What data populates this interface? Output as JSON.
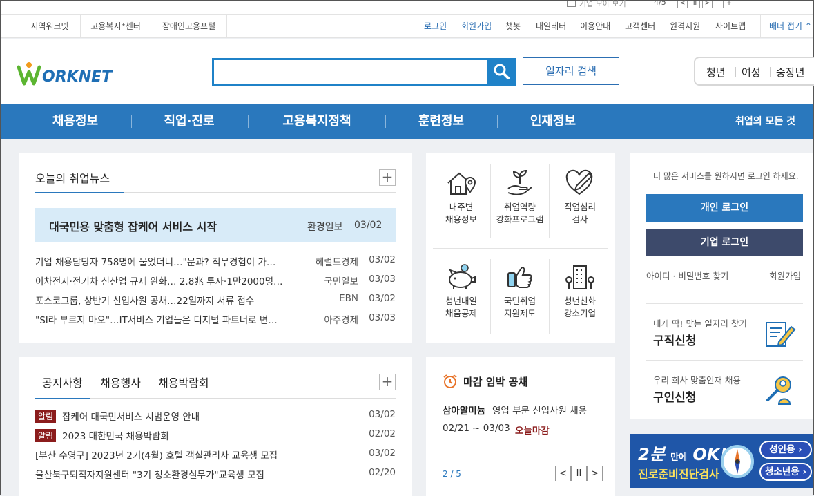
{
  "top_strip": {
    "faded_text": "기업 모아 보기",
    "page": "4/5",
    "pause": "II",
    "prev": "<",
    "next": ">",
    "plus": "+"
  },
  "util": {
    "left_links": [
      "지역워크넷",
      "고용복지⁺센터",
      "장애인고용포털"
    ],
    "right_links": [
      "로그인",
      "회원가입",
      "챗봇",
      "내일레터",
      "이용안내",
      "고객센터",
      "원격지원",
      "사이트맵"
    ],
    "banner_fold": "배너 접기"
  },
  "header": {
    "logo_text": "WORKNET",
    "search_placeholder": "",
    "job_search_label": "일자리 검색",
    "targets": [
      "청년",
      "여성",
      "중장년"
    ]
  },
  "gnb": {
    "items": [
      "채용정보",
      "직업·진로",
      "고용복지정책",
      "훈련정보",
      "인재정보"
    ],
    "all_label": "취업의 모든 것"
  },
  "news": {
    "title": "오늘의 취업뉴스",
    "highlight": {
      "title": "대국민용 맞춤형 잡케어 서비스 시작",
      "source": "환경일보",
      "date": "03/02"
    },
    "items": [
      {
        "title": "기업 채용담당자 758명에 물었더니…\"문과? 직무경험이 가…",
        "source": "헤럴드경제",
        "date": "03/02"
      },
      {
        "title": "이차전지·전기차 신산업 규제 완화… 2.8兆 투자·1만2000명…",
        "source": "국민일보",
        "date": "03/03"
      },
      {
        "title": "포스코그룹, 상반기 신입사원 공채…22일까지 서류 접수",
        "source": "EBN",
        "date": "03/02"
      },
      {
        "title": "\"SI라 부르지 마오\"…IT서비스 기업들은 디지털 파트너로 변…",
        "source": "아주경제",
        "date": "03/03"
      }
    ]
  },
  "services": {
    "items": [
      {
        "label_line1": "내주변",
        "label_line2": "채용정보",
        "icon": "house-location-icon"
      },
      {
        "label_line1": "취업역량",
        "label_line2": "강화프로그램",
        "icon": "hand-sprout-icon"
      },
      {
        "label_line1": "직업심리",
        "label_line2": "검사",
        "icon": "heart-pen-icon"
      },
      {
        "label_line1": "청년내일",
        "label_line2": "채움공제",
        "icon": "piggy-bank-icon"
      },
      {
        "label_line1": "국민취업",
        "label_line2": "지원제도",
        "icon": "thumbs-up-phone-icon"
      },
      {
        "label_line1": "청년친화",
        "label_line2": "강소기업",
        "icon": "building-icon"
      }
    ]
  },
  "login": {
    "hint": "더 많은 서비스를 원하시면 로그인 하세요.",
    "personal": "개인 로그인",
    "company": "기업 로그인",
    "find": "아이디 · 비밀번호 찾기",
    "join": "회원가입",
    "job_seek": {
      "sub": "내게 딱! 맞는 일자리 찾기",
      "main": "구직신청"
    },
    "job_offer": {
      "sub": "우리 회사 맞춤인재 채용",
      "main": "구인신청"
    }
  },
  "notice": {
    "tabs": [
      "공지사항",
      "채용행사",
      "채용박람회"
    ],
    "items": [
      {
        "badge": "알림",
        "title": "잡케어 대국민서비스 시범운영 안내",
        "date": "03/02"
      },
      {
        "badge": "알림",
        "title": "2023 대한민국 채용박람회",
        "date": "02/02"
      },
      {
        "badge": "",
        "title": "[부산 수영구] 2023년 2기(4월) 호텔 객실관리사 교육생 모집",
        "date": "03/02"
      },
      {
        "badge": "",
        "title": "울산북구퇴직자지원센터 \"3기 청소환경실무가\"교육생 모집",
        "date": "02/20"
      }
    ]
  },
  "deadline": {
    "title": "마감 임박 공채",
    "company": "삼아알미늄",
    "job": "영업 부문 신입사원 채용",
    "period": "02/21 ~ 03/03",
    "today": "오늘마감",
    "page": "2 / 5",
    "prev": "<",
    "pause": "II",
    "next": ">"
  },
  "ad": {
    "line1_big": "2분",
    "line1_small": "만에",
    "line1_ok": "OK!",
    "line2": "진로준비진단검사",
    "adult": "성인용 ›",
    "youth": "청소년용 ›"
  },
  "colors": {
    "brand_blue": "#2a78bd",
    "search_blue": "#1f82c8",
    "company_navy": "#3d4a6b",
    "badge_red": "#8b1c1c",
    "logo_green": "#5cb531"
  }
}
